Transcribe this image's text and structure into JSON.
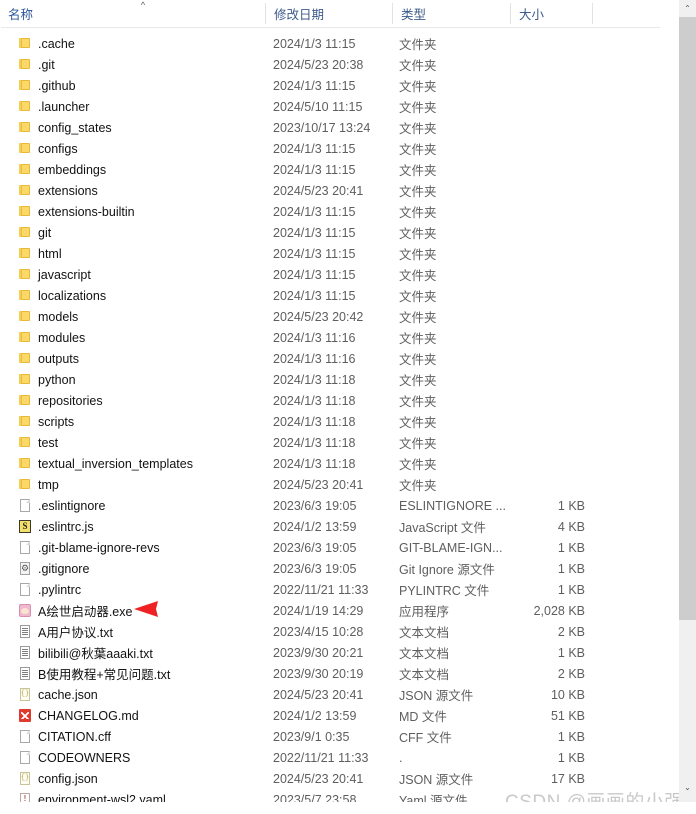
{
  "window": {
    "type": "file-explorer-list",
    "accent_color": "#2b579a",
    "watermark": "CSDN @画画的小强"
  },
  "columns": {
    "name": "名称",
    "date_modified": "修改日期",
    "type": "类型",
    "size": "大小",
    "sort_indicator": "^",
    "sorted_by": "名称",
    "sort_direction": "ascending"
  },
  "scrollbar": {
    "up_arrow": "⌃",
    "down_arrow": "⌄"
  },
  "annotation": {
    "arrow_color": "#ee2222",
    "points_to": "A绘世启动器.exe"
  },
  "files": [
    {
      "name": ".cache",
      "date": "2024/1/3 11:15",
      "type": "文件夹",
      "size": "",
      "icon": "folder-icon"
    },
    {
      "name": ".git",
      "date": "2024/5/23 20:38",
      "type": "文件夹",
      "size": "",
      "icon": "folder-icon"
    },
    {
      "name": ".github",
      "date": "2024/1/3 11:15",
      "type": "文件夹",
      "size": "",
      "icon": "folder-icon"
    },
    {
      "name": ".launcher",
      "date": "2024/5/10 11:15",
      "type": "文件夹",
      "size": "",
      "icon": "folder-icon"
    },
    {
      "name": "config_states",
      "date": "2023/10/17 13:24",
      "type": "文件夹",
      "size": "",
      "icon": "folder-icon"
    },
    {
      "name": "configs",
      "date": "2024/1/3 11:15",
      "type": "文件夹",
      "size": "",
      "icon": "folder-icon"
    },
    {
      "name": "embeddings",
      "date": "2024/1/3 11:15",
      "type": "文件夹",
      "size": "",
      "icon": "folder-icon"
    },
    {
      "name": "extensions",
      "date": "2024/5/23 20:41",
      "type": "文件夹",
      "size": "",
      "icon": "folder-icon"
    },
    {
      "name": "extensions-builtin",
      "date": "2024/1/3 11:15",
      "type": "文件夹",
      "size": "",
      "icon": "folder-icon"
    },
    {
      "name": "git",
      "date": "2024/1/3 11:15",
      "type": "文件夹",
      "size": "",
      "icon": "folder-icon"
    },
    {
      "name": "html",
      "date": "2024/1/3 11:15",
      "type": "文件夹",
      "size": "",
      "icon": "folder-icon"
    },
    {
      "name": "javascript",
      "date": "2024/1/3 11:15",
      "type": "文件夹",
      "size": "",
      "icon": "folder-icon"
    },
    {
      "name": "localizations",
      "date": "2024/1/3 11:15",
      "type": "文件夹",
      "size": "",
      "icon": "folder-icon"
    },
    {
      "name": "models",
      "date": "2024/5/23 20:42",
      "type": "文件夹",
      "size": "",
      "icon": "folder-icon"
    },
    {
      "name": "modules",
      "date": "2024/1/3 11:16",
      "type": "文件夹",
      "size": "",
      "icon": "folder-icon"
    },
    {
      "name": "outputs",
      "date": "2024/1/3 11:16",
      "type": "文件夹",
      "size": "",
      "icon": "folder-icon"
    },
    {
      "name": "python",
      "date": "2024/1/3 11:18",
      "type": "文件夹",
      "size": "",
      "icon": "folder-icon"
    },
    {
      "name": "repositories",
      "date": "2024/1/3 11:18",
      "type": "文件夹",
      "size": "",
      "icon": "folder-icon"
    },
    {
      "name": "scripts",
      "date": "2024/1/3 11:18",
      "type": "文件夹",
      "size": "",
      "icon": "folder-icon"
    },
    {
      "name": "test",
      "date": "2024/1/3 11:18",
      "type": "文件夹",
      "size": "",
      "icon": "folder-icon"
    },
    {
      "name": "textual_inversion_templates",
      "date": "2024/1/3 11:18",
      "type": "文件夹",
      "size": "",
      "icon": "folder-icon"
    },
    {
      "name": "tmp",
      "date": "2024/5/23 20:41",
      "type": "文件夹",
      "size": "",
      "icon": "folder-icon"
    },
    {
      "name": ".eslintignore",
      "date": "2023/6/3 19:05",
      "type": "ESLINTIGNORE ...",
      "size": "1 KB",
      "icon": "page-icon"
    },
    {
      "name": ".eslintrc.js",
      "date": "2024/1/2 13:59",
      "type": "JavaScript 文件",
      "size": "4 KB",
      "icon": "javascript-icon"
    },
    {
      "name": ".git-blame-ignore-revs",
      "date": "2023/6/3 19:05",
      "type": "GIT-BLAME-IGN...",
      "size": "1 KB",
      "icon": "page-icon"
    },
    {
      "name": ".gitignore",
      "date": "2023/6/3 19:05",
      "type": "Git Ignore 源文件",
      "size": "1 KB",
      "icon": "gear-icon"
    },
    {
      "name": ".pylintrc",
      "date": "2022/11/21 11:33",
      "type": "PYLINTRC 文件",
      "size": "1 KB",
      "icon": "page-icon"
    },
    {
      "name": "A绘世启动器.exe",
      "date": "2024/1/19 14:29",
      "type": "应用程序",
      "size": "2,028 KB",
      "icon": "application-icon"
    },
    {
      "name": "A用户协议.txt",
      "date": "2023/4/15 10:28",
      "type": "文本文档",
      "size": "2 KB",
      "icon": "text-document-icon"
    },
    {
      "name": "bilibili@秋葉aaaki.txt",
      "date": "2023/9/30 20:21",
      "type": "文本文档",
      "size": "1 KB",
      "icon": "text-document-icon"
    },
    {
      "name": "B使用教程+常见问题.txt",
      "date": "2023/9/30 20:19",
      "type": "文本文档",
      "size": "2 KB",
      "icon": "text-document-icon"
    },
    {
      "name": "cache.json",
      "date": "2024/5/23 20:41",
      "type": "JSON 源文件",
      "size": "10 KB",
      "icon": "json-icon"
    },
    {
      "name": "CHANGELOG.md",
      "date": "2024/1/2 13:59",
      "type": "MD 文件",
      "size": "51 KB",
      "icon": "markdown-icon"
    },
    {
      "name": "CITATION.cff",
      "date": "2023/9/1 0:35",
      "type": "CFF 文件",
      "size": "1 KB",
      "icon": "page-icon"
    },
    {
      "name": "CODEOWNERS",
      "date": "2022/11/21 11:33",
      "type": ".",
      "size": "1 KB",
      "icon": "page-icon"
    },
    {
      "name": "config.json",
      "date": "2024/5/23 20:41",
      "type": "JSON 源文件",
      "size": "17 KB",
      "icon": "json-icon"
    },
    {
      "name": "environment-wsl2.yaml",
      "date": "2023/5/7 23:58",
      "type": "Yaml 源文件",
      "size": "",
      "icon": "yaml-icon"
    }
  ]
}
